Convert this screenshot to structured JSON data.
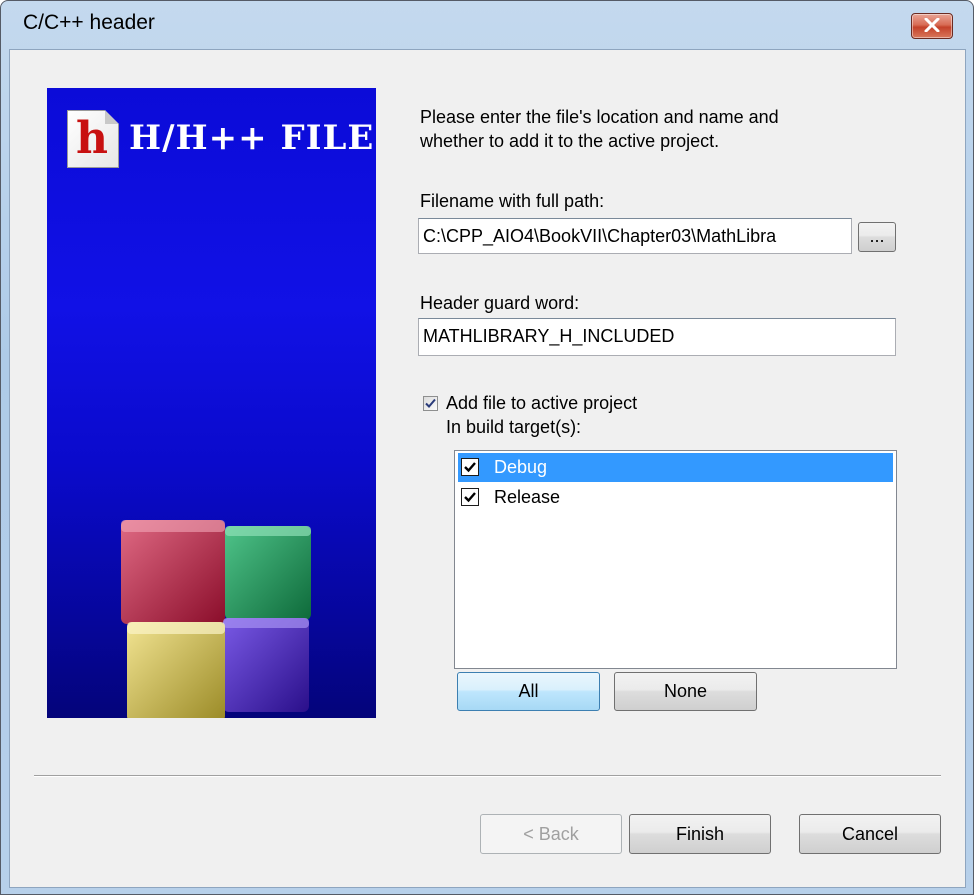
{
  "window": {
    "title": "C/C++ header"
  },
  "banner": {
    "icon_letter": "h",
    "title": "H/H++ FILE"
  },
  "intro": {
    "line1": "Please enter the file's location and name and",
    "line2": "whether to add it to the active project."
  },
  "filename": {
    "label": "Filename with full path:",
    "value": "C:\\CPP_AIO4\\BookVII\\Chapter03\\MathLibra",
    "browse_label": "..."
  },
  "header_guard": {
    "label": "Header guard word:",
    "value": "MATHLIBRARY_H_INCLUDED"
  },
  "add_to_project": {
    "label": "Add file to active project",
    "checked": true
  },
  "build_targets": {
    "label": "In build target(s):",
    "items": [
      {
        "label": "Debug",
        "checked": true,
        "selected": true
      },
      {
        "label": "Release",
        "checked": true,
        "selected": false
      }
    ],
    "all_label": "All",
    "none_label": "None"
  },
  "footer": {
    "back_label": "< Back",
    "finish_label": "Finish",
    "cancel_label": "Cancel"
  },
  "colors": {
    "banner_blue": "#0b0bd8",
    "selection_blue": "#3399ff"
  }
}
